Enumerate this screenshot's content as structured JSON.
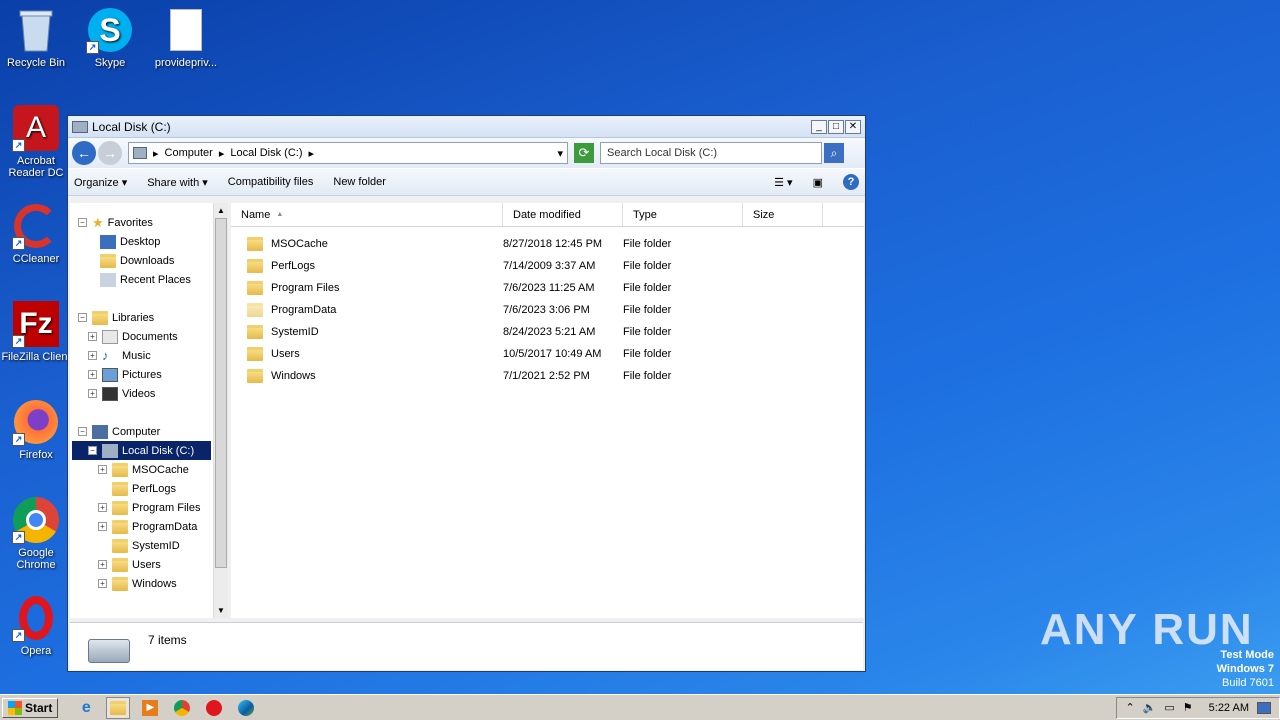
{
  "desktop": {
    "icons": [
      {
        "label": "Recycle Bin"
      },
      {
        "label": "Skype"
      },
      {
        "label": "providepriv..."
      },
      {
        "label": "Acrobat Reader DC"
      },
      {
        "label": "CCleaner"
      },
      {
        "label": "FileZilla Client"
      },
      {
        "label": "Firefox"
      },
      {
        "label": "Google Chrome"
      },
      {
        "label": "Opera"
      }
    ],
    "watermark": "ANY RUN",
    "test_mode": {
      "line1": "Test Mode",
      "line2": "Windows 7",
      "line3": "Build 7601"
    }
  },
  "window": {
    "title": "Local Disk (C:)",
    "controls": {
      "minimize": "_",
      "maximize": "□",
      "close": "✕"
    },
    "address": {
      "crumbs": [
        "Computer",
        "Local Disk (C:)"
      ]
    },
    "search_placeholder": "Search Local Disk (C:)",
    "toolbar": {
      "organize": "Organize",
      "share": "Share with",
      "compat": "Compatibility files",
      "new_folder": "New folder"
    },
    "nav": {
      "favorites": "Favorites",
      "fav_items": [
        "Desktop",
        "Downloads",
        "Recent Places"
      ],
      "libraries": "Libraries",
      "lib_items": [
        "Documents",
        "Music",
        "Pictures",
        "Videos"
      ],
      "computer": "Computer",
      "local_disk": "Local Disk (C:)",
      "disk_items": [
        "MSOCache",
        "PerfLogs",
        "Program Files",
        "ProgramData",
        "SystemID",
        "Users",
        "Windows"
      ]
    },
    "columns": {
      "name": "Name",
      "date": "Date modified",
      "type": "Type",
      "size": "Size"
    },
    "rows": [
      {
        "name": "MSOCache",
        "date": "8/27/2018 12:45 PM",
        "type": "File folder"
      },
      {
        "name": "PerfLogs",
        "date": "7/14/2009 3:37 AM",
        "type": "File folder"
      },
      {
        "name": "Program Files",
        "date": "7/6/2023 11:25 AM",
        "type": "File folder"
      },
      {
        "name": "ProgramData",
        "date": "7/6/2023 3:06 PM",
        "type": "File folder"
      },
      {
        "name": "SystemID",
        "date": "8/24/2023 5:21 AM",
        "type": "File folder"
      },
      {
        "name": "Users",
        "date": "10/5/2017 10:49 AM",
        "type": "File folder"
      },
      {
        "name": "Windows",
        "date": "7/1/2021 2:52 PM",
        "type": "File folder"
      }
    ],
    "status": "7 items"
  },
  "taskbar": {
    "start": "Start",
    "clock": "5:22 AM"
  }
}
